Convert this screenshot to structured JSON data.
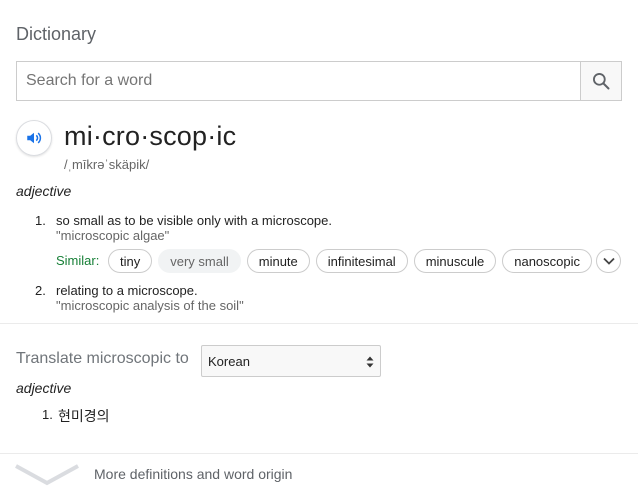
{
  "header": {
    "title": "Dictionary"
  },
  "search": {
    "placeholder": "Search for a word",
    "icon": "search-icon"
  },
  "entry": {
    "headword": "mi·cro·scop·ic",
    "pronunciation": "/ˌmīkrəˈskäpik/",
    "part_of_speech": "adjective",
    "senses": [
      {
        "number": "1.",
        "definition": "so small as to be visible only with a microscope.",
        "example": "\"microscopic algae\"",
        "similar_label": "Similar:",
        "similar": [
          "tiny",
          "very small",
          "minute",
          "infinitesimal",
          "minuscule",
          "nanoscopic"
        ]
      },
      {
        "number": "2.",
        "definition": "relating to a microscope.",
        "example": "\"microscopic analysis of the soil\""
      }
    ]
  },
  "translate": {
    "label": "Translate microscopic to",
    "language": "Korean",
    "part_of_speech": "adjective",
    "results": [
      {
        "number": "1.",
        "word": "현미경의"
      }
    ]
  },
  "footer": {
    "more_label": "More definitions and word origin"
  },
  "colors": {
    "accent_blue": "#1a73e8",
    "similar_green": "#188038"
  }
}
